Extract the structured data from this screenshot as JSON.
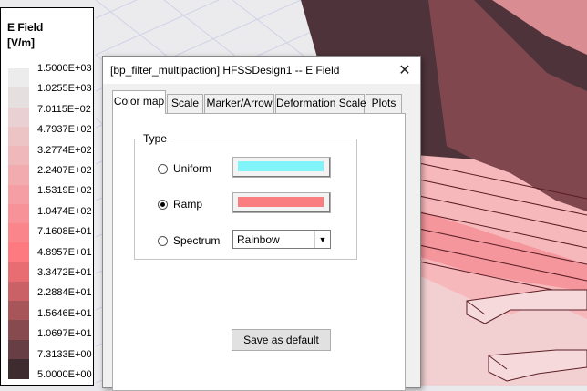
{
  "legend": {
    "title": "E Field\n[V/m]",
    "entries": [
      {
        "label": "1.5000E+03",
        "color": "#ececec"
      },
      {
        "label": "1.0255E+03",
        "color": "#e6dfe0"
      },
      {
        "label": "7.0115E+02",
        "color": "#e9d0d2"
      },
      {
        "label": "4.7937E+02",
        "color": "#ecc4c6"
      },
      {
        "label": "3.2774E+02",
        "color": "#efb8bb"
      },
      {
        "label": "2.2407E+02",
        "color": "#f2acb0"
      },
      {
        "label": "1.5319E+02",
        "color": "#f59fa4"
      },
      {
        "label": "1.0474E+02",
        "color": "#f79398"
      },
      {
        "label": "7.1608E+01",
        "color": "#fa868c"
      },
      {
        "label": "4.8957E+01",
        "color": "#fd7a80"
      },
      {
        "label": "3.3472E+01",
        "color": "#e86d72"
      },
      {
        "label": "2.2884E+01",
        "color": "#c96166"
      },
      {
        "label": "1.5646E+01",
        "color": "#a8555a"
      },
      {
        "label": "1.0697E+01",
        "color": "#874a4f"
      },
      {
        "label": "7.3133E+00",
        "color": "#673e44"
      },
      {
        "label": "5.0000E+00",
        "color": "#3e2b30"
      }
    ]
  },
  "dialog": {
    "title": "[bp_filter_multipaction] HFSSDesign1 -- E Field",
    "close_glyph": "✕",
    "tabs": [
      {
        "label": "Color map"
      },
      {
        "label": "Scale"
      },
      {
        "label": "Marker/Arrow"
      },
      {
        "label": "Deformation Scale"
      },
      {
        "label": "Plots"
      }
    ],
    "type_group": {
      "label": "Type",
      "options": [
        {
          "label": "Uniform",
          "checked": false,
          "color": "#80f4f8"
        },
        {
          "label": "Ramp",
          "checked": true,
          "color": "#fa7e80"
        },
        {
          "label": "Spectrum",
          "checked": false
        }
      ],
      "spectrum_value": "Rainbow"
    },
    "save_default_label": "Save as default"
  }
}
